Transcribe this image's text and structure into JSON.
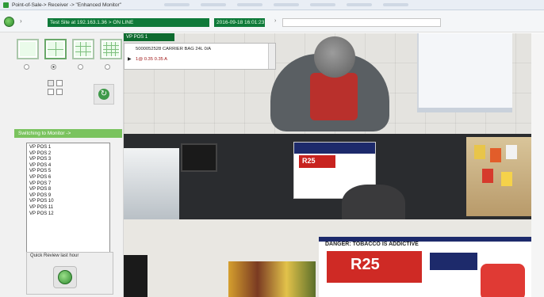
{
  "titlebar": {
    "title": "Point-of-Sale-> Receiver -> \"Enhanced Monitor\""
  },
  "nav": {
    "path": "Test Site at 192.163.1.36 > ON LINE",
    "datetime": "2016-09-18 16:01:23"
  },
  "left": {
    "switch_label": "Switching to Monitor ->",
    "pos_items": [
      "VP POS 1",
      "VP POS 2",
      "VP POS 3",
      "VP POS 4",
      "VP POS 5",
      "VP POS 6",
      "VP POS 7",
      "VP POS 8",
      "VP POS 9",
      "VP POS 10",
      "VP POS 11",
      "VP POS 12"
    ],
    "quick_label": "Quick Review last hour"
  },
  "video": {
    "cam_label": "VP POS 1",
    "receipt_line1": "5000052528 CARRIER BAG 24L   0/A",
    "receipt_line2": "1@   0.35   0.35 A",
    "brand_sign": "R25",
    "danger_text": "DANGER: TOBACCO IS ADDICTIVE",
    "brand_sign2": "R25"
  },
  "colors": {
    "accent_green": "#0f7a3a",
    "label_green": "#7ac35e",
    "brand_blue": "#1d2a6b",
    "brand_red": "#cf2a25"
  },
  "icons": {
    "app": "app-icon",
    "globe": "globe-icon",
    "refresh": "refresh-icon",
    "play": "play-icon"
  }
}
